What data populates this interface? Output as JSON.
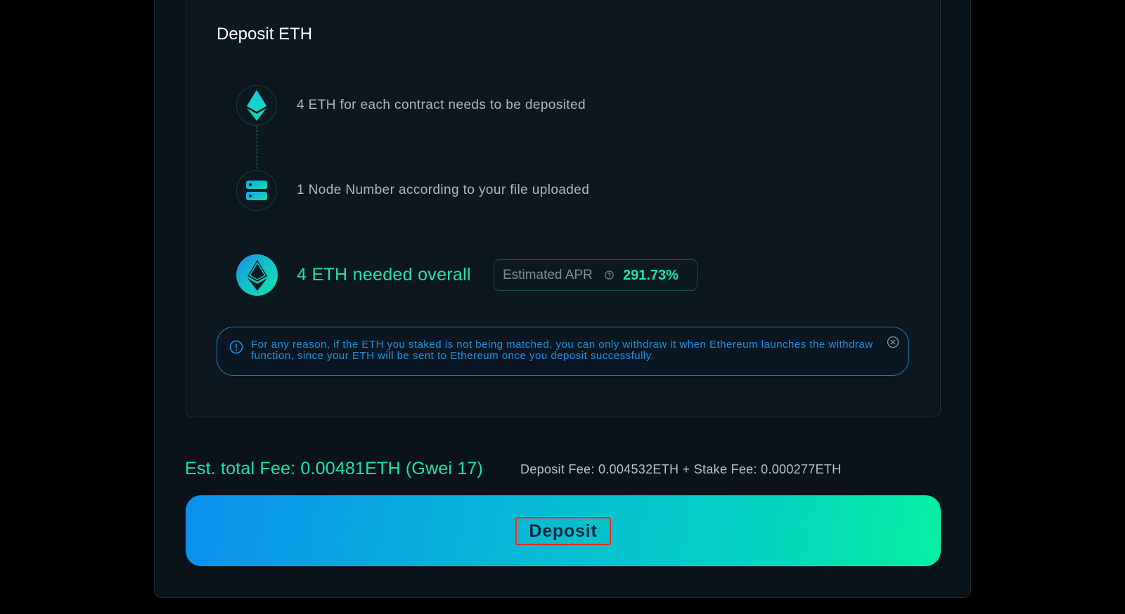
{
  "card": {
    "title": "Deposit ETH"
  },
  "steps": [
    {
      "icon": "ethereum-icon",
      "text": "4 ETH for each contract needs to be deposited"
    },
    {
      "icon": "server-icon",
      "text": "1 Node Number according to your file uploaded"
    }
  ],
  "summary": {
    "icon": "ethereum-icon",
    "total_text": "4 ETH needed overall",
    "apr_label": "Estimated APR",
    "apr_value": "291.73%"
  },
  "notice": {
    "icon": "info-icon",
    "text": "For any reason, if the ETH you staked is not being matched, you can only withdraw it when Ethereum launches the withdraw function, since your ETH will be sent to Ethereum once you deposit successfully.",
    "close_icon": "close-circle-icon"
  },
  "fees": {
    "total": "Est. total Fee: 0.00481ETH (Gwei 17)",
    "breakdown": "Deposit Fee: 0.004532ETH + Stake Fee: 0.000277ETH"
  },
  "deposit_button": {
    "label": "Deposit"
  },
  "colors": {
    "accent_green": "#19e3a8",
    "notice_blue": "#1f8fe0",
    "gradient_start": "#0c8fee",
    "gradient_end": "#05f0a2",
    "highlight_red": "#ff2a1a"
  }
}
